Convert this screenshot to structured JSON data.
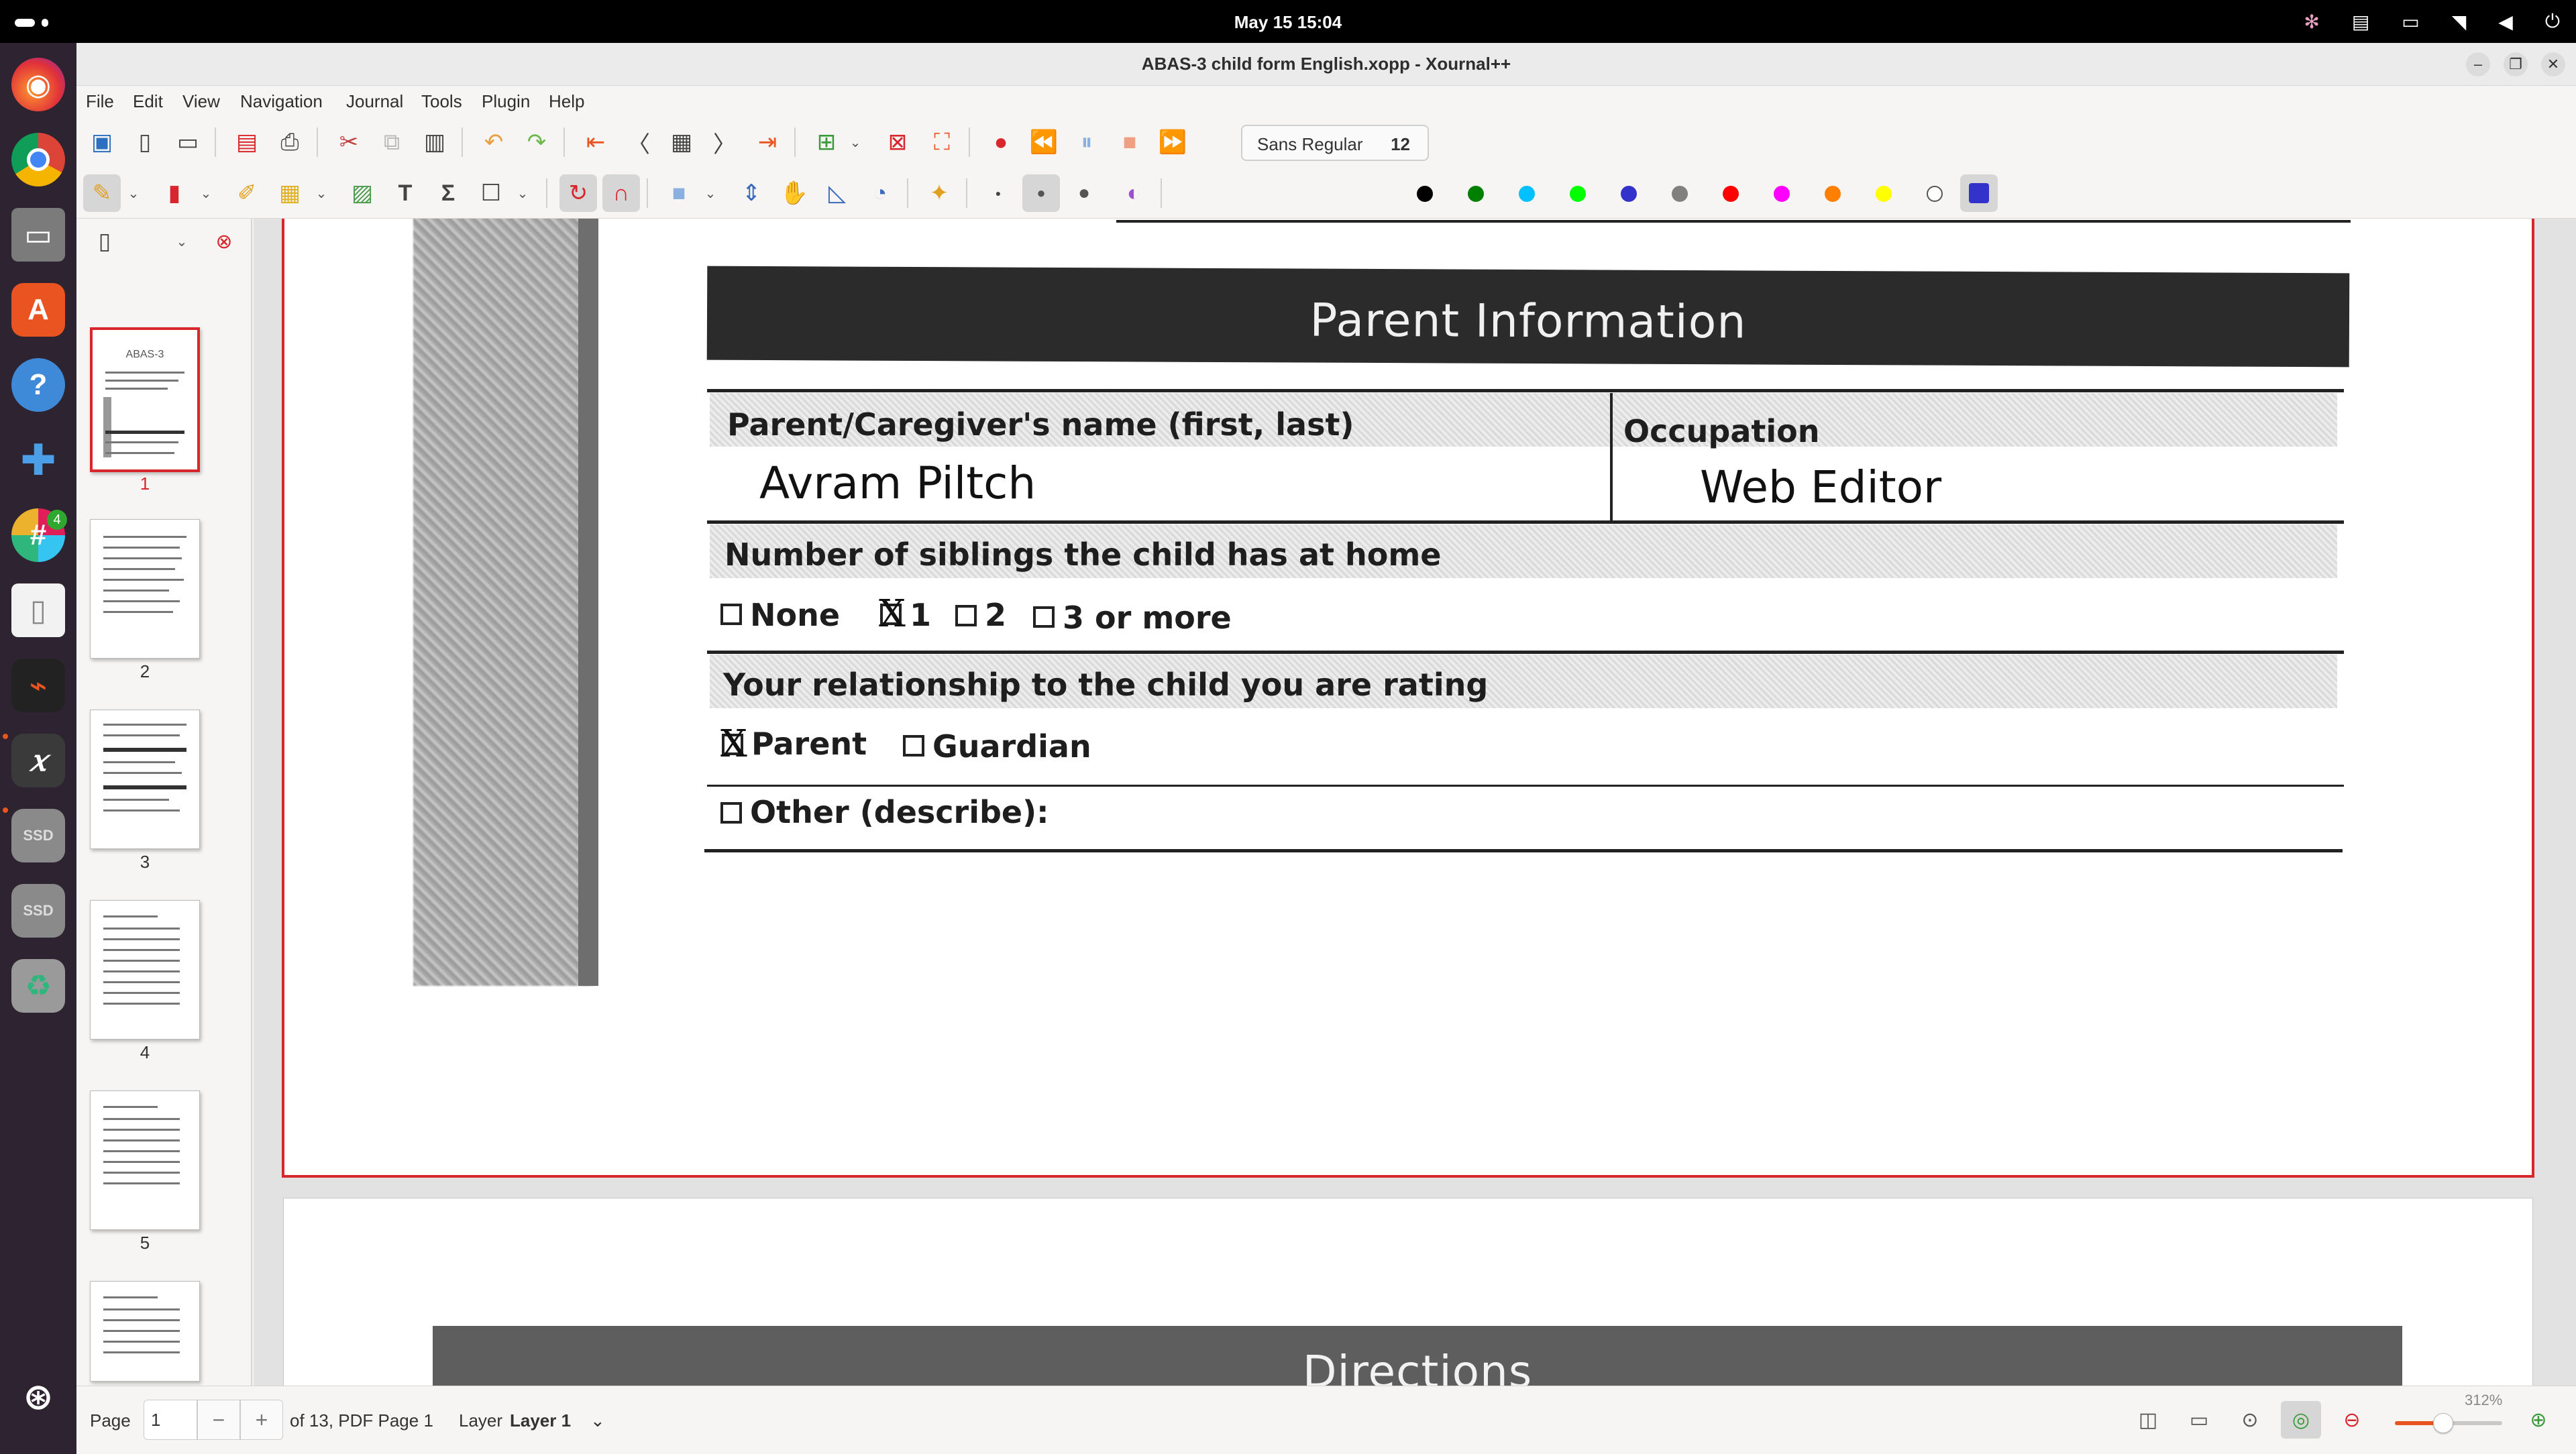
{
  "topbar": {
    "clock": "May 15  15:04"
  },
  "dock": {
    "slack_badge": "4"
  },
  "window": {
    "title": "ABAS-3 child form English.xopp - Xournal++"
  },
  "menu": [
    "File",
    "Edit",
    "View",
    "Navigation",
    "Journal",
    "Tools",
    "Plugin",
    "Help"
  ],
  "toolbar": {
    "font_name": "Sans Regular",
    "font_size": "12"
  },
  "palette": [
    "#000000",
    "#008000",
    "#00c0ff",
    "#00ff00",
    "#3333cc",
    "#808080",
    "#ff0000",
    "#ff00ff",
    "#ff8000",
    "#ffff00",
    "#ffffff",
    "#3333cc"
  ],
  "sidebar": {
    "pages": [
      "1",
      "2",
      "3",
      "4",
      "5"
    ]
  },
  "thumb1": {
    "title": "ABAS-3"
  },
  "form": {
    "header": "Parent Information",
    "name_label": "Parent/Caregiver's name (first, last)",
    "name_value": "Avram Piltch",
    "occupation_label": "Occupation",
    "occupation_value": "Web Editor",
    "siblings_label": "Number of siblings the child has at home",
    "siblings_options": [
      "None",
      "1",
      "2",
      "3 or more"
    ],
    "relationship_label": "Your relationship to the child you are rating",
    "relationship_options": [
      "Parent",
      "Guardian"
    ],
    "other_label": "Other (describe):"
  },
  "page2": {
    "header": "Directions"
  },
  "status": {
    "page_label": "Page",
    "page_value": "1",
    "page_of": "of 13, PDF Page 1",
    "layer_label": "Layer",
    "layer_value": "Layer 1",
    "zoom": "312%",
    "zoom_level": 0.45
  }
}
